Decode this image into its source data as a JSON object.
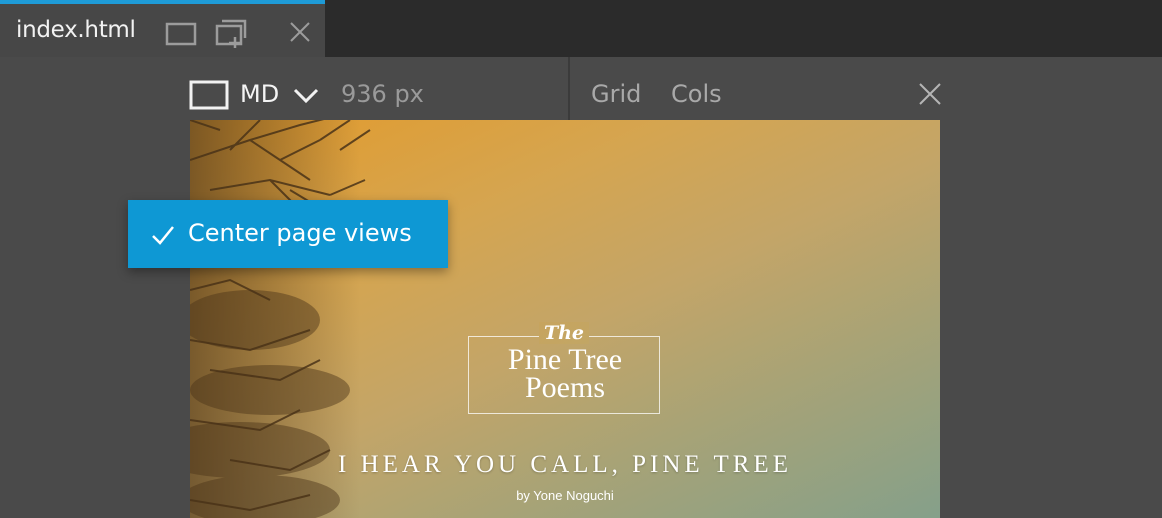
{
  "tab": {
    "title": "index.html",
    "accent_color": "#1e9bd7"
  },
  "toolbar": {
    "view_icon": "device-frame-icon",
    "breakpoint": "MD",
    "width": "936 px",
    "grid_label": "Grid",
    "cols_label": "Cols"
  },
  "preview": {
    "logo_the": "The",
    "logo_line1": "Pine Tree",
    "logo_line2": "Poems",
    "poem_title": "I HEAR YOU CALL, PINE TREE",
    "poem_author": "by Yone Noguchi"
  },
  "menu": {
    "item_label": "Center page views",
    "checked": true,
    "color": "#0e98d4"
  }
}
